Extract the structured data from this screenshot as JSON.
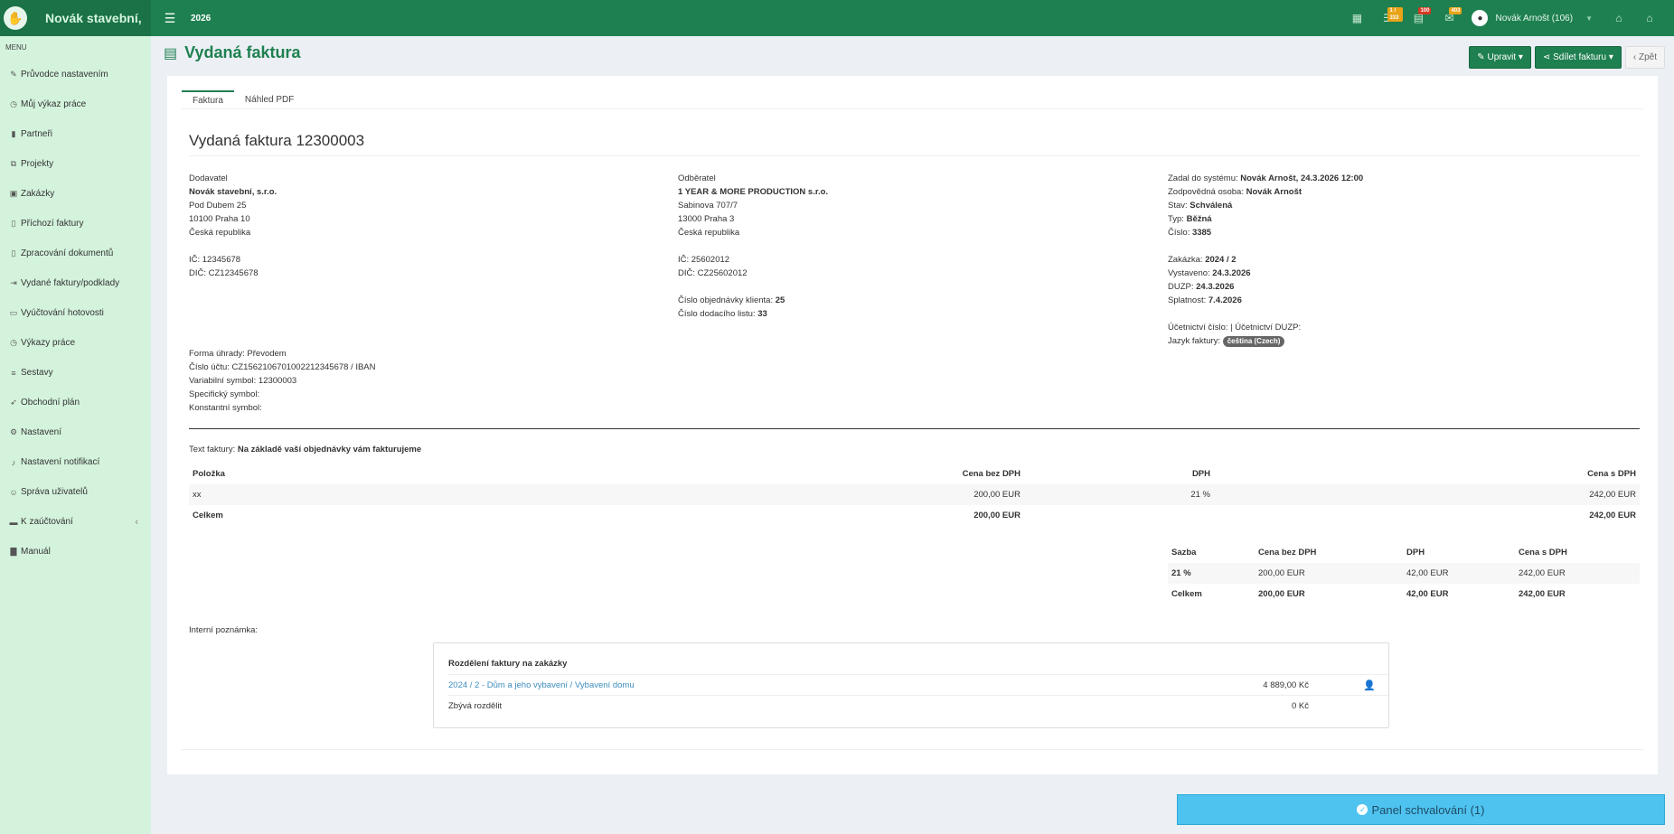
{
  "topbar": {
    "brand": "Novák stavební,",
    "year": "2026",
    "badges": {
      "tasks": "1 / 333",
      "alerts": "100",
      "messages": "403"
    },
    "user": "Novák Arnošt (106)"
  },
  "sidebar": {
    "header": "MENU",
    "items": [
      {
        "label": "Průvodce nastavením",
        "icon": "pencil-icon"
      },
      {
        "label": "Můj výkaz práce",
        "icon": "clock-icon"
      },
      {
        "label": "Partneři",
        "icon": "bookmark-icon"
      },
      {
        "label": "Projekty",
        "icon": "cubes-icon"
      },
      {
        "label": "Zakázky",
        "icon": "box-icon"
      },
      {
        "label": "Příchozí faktury",
        "icon": "file-icon"
      },
      {
        "label": "Zpracování dokumentů",
        "icon": "file-icon"
      },
      {
        "label": "Vydané faktury/podklady",
        "icon": "file-arrow-icon"
      },
      {
        "label": "Vyúčtování hotovosti",
        "icon": "money-icon"
      },
      {
        "label": "Výkazy práce",
        "icon": "clock-icon"
      },
      {
        "label": "Sestavy",
        "icon": "list-icon"
      },
      {
        "label": "Obchodní plán",
        "icon": "rocket-icon"
      },
      {
        "label": "Nastavení",
        "icon": "gears-icon"
      },
      {
        "label": "Nastavení notifikací",
        "icon": "bell-icon"
      },
      {
        "label": "Správa uživatelů",
        "icon": "users-icon"
      },
      {
        "label": "K zaúčtování",
        "icon": "folder-icon"
      },
      {
        "label": "Manuál",
        "icon": "book-icon"
      }
    ]
  },
  "page": {
    "title": "Vydaná faktura",
    "edit": "Upravit",
    "share": "Sdílet fakturu",
    "back": "Zpět"
  },
  "tabs": [
    "Faktura",
    "Náhled PDF"
  ],
  "invoice": {
    "heading": "Vydaná faktura 12300003",
    "supplier": {
      "label": "Dodavatel",
      "name": "Novák stavební, s.r.o.",
      "street": "Pod Dubem 25",
      "city": "10100 Praha 10",
      "country": "Česká republika",
      "ic": "IČ: 12345678",
      "dic": "DIČ: CZ12345678"
    },
    "customer": {
      "label": "Odběratel",
      "name": "1 YEAR & MORE PRODUCTION s.r.o.",
      "street": "Sabinova 707/7",
      "city": "13000 Praha 3",
      "country": "Česká republika",
      "ic": "IČ: 25602012",
      "dic": "DIČ: CZ25602012",
      "order_label": "Číslo objednávky klienta:",
      "order_value": "25",
      "delivery_label": "Číslo dodacího listu:",
      "delivery_value": "33"
    },
    "meta": {
      "entered_label": "Zadal do systému:",
      "entered_value": "Novák Arnošt, 24.3.2026 12:00",
      "responsible_label": "Zodpovědná osoba:",
      "responsible_value": "Novák Arnošt",
      "state_label": "Stav:",
      "state_value": "Schválená",
      "type_label": "Typ:",
      "type_value": "Běžná",
      "number_label": "Číslo:",
      "number_value": "3385",
      "order_label": "Zakázka:",
      "order_value": "2024 / 2",
      "issued_label": "Vystaveno:",
      "issued_value": "24.3.2026",
      "duzp_label": "DUZP:",
      "duzp_value": "24.3.2026",
      "due_label": "Splatnost:",
      "due_value": "7.4.2026",
      "accounting": "Účetnictví číslo: | Účetnictví DUZP:",
      "lang_label": "Jazyk faktury:",
      "lang_value": "čeština (Czech)"
    },
    "payment": {
      "method": "Forma úhrady: Převodem",
      "account": "Číslo účtu: CZ1562106701002212345678 / IBAN",
      "vs": "Variabilní symbol: 12300003",
      "ss": "Specifický symbol:",
      "ks": "Konstantní symbol:"
    },
    "text_label": "Text faktury:",
    "text_value": "Na základě vaší objednávky vám fakturujeme",
    "items_header": {
      "item": "Položka",
      "net": "Cena bez DPH",
      "vat": "DPH",
      "gross": "Cena s DPH"
    },
    "items": [
      {
        "item": "xx",
        "net": "200,00 EUR",
        "vat": "21 %",
        "gross": "242,00 EUR"
      }
    ],
    "items_total": {
      "label": "Celkem",
      "net": "200,00 EUR",
      "gross": "242,00 EUR"
    },
    "vat_header": {
      "rate": "Sazba",
      "net": "Cena bez DPH",
      "vat": "DPH",
      "gross": "Cena s DPH"
    },
    "vat_rows": [
      {
        "rate": "21 %",
        "net": "200,00 EUR",
        "vat": "42,00 EUR",
        "gross": "242,00 EUR"
      }
    ],
    "vat_total": {
      "label": "Celkem",
      "net": "200,00 EUR",
      "vat": "42,00 EUR",
      "gross": "242,00 EUR"
    },
    "internal_note": "Interní poznámka:",
    "split": {
      "title": "Rozdělení faktury na zakázky",
      "link": "2024 / 2 - Dům a jeho vybavení / Vybavení domu",
      "link_amount": "4 889,00 Kč",
      "remaining_label": "Zbývá rozdělit",
      "remaining_amount": "0 Kč"
    }
  },
  "approval_panel": "Panel schvalování  (1)"
}
